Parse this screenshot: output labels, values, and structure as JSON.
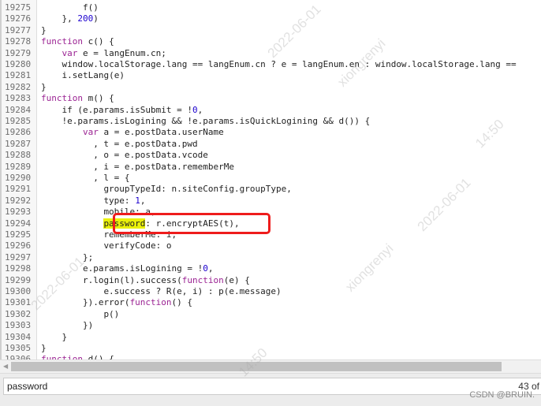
{
  "editor": {
    "lines": [
      {
        "n": "19275",
        "indent": 12,
        "parts": [
          [
            "",
            "f()"
          ]
        ]
      },
      {
        "n": "19276",
        "indent": 8,
        "parts": [
          [
            "",
            "}, "
          ],
          [
            "num",
            "200"
          ],
          [
            "",
            ")"
          ]
        ]
      },
      {
        "n": "19277",
        "indent": 4,
        "parts": [
          [
            "",
            "}"
          ]
        ]
      },
      {
        "n": "19278",
        "indent": 4,
        "parts": [
          [
            "kw",
            "function"
          ],
          [
            "",
            " c() {"
          ]
        ]
      },
      {
        "n": "19279",
        "indent": 8,
        "parts": [
          [
            "kw",
            "var"
          ],
          [
            "",
            " e = langEnum.cn;"
          ]
        ]
      },
      {
        "n": "19280",
        "indent": 8,
        "parts": [
          [
            "",
            "window.localStorage.lang == langEnum.cn ? e = langEnum.en : window.localStorage.lang =="
          ]
        ]
      },
      {
        "n": "19281",
        "indent": 8,
        "parts": [
          [
            "",
            "i.setLang(e)"
          ]
        ]
      },
      {
        "n": "19282",
        "indent": 4,
        "parts": [
          [
            "",
            "}"
          ]
        ]
      },
      {
        "n": "19283",
        "indent": 4,
        "parts": [
          [
            "kw",
            "function"
          ],
          [
            "",
            " m() {"
          ]
        ]
      },
      {
        "n": "19284",
        "indent": 8,
        "parts": [
          [
            "",
            "if (e.params.isSubmit = !"
          ],
          [
            "num",
            "0"
          ],
          [
            "",
            ","
          ]
        ]
      },
      {
        "n": "19285",
        "indent": 8,
        "parts": [
          [
            "",
            "!e.params.isLogining && !e.params.isQuickLogining && d()) {"
          ]
        ]
      },
      {
        "n": "19286",
        "indent": 12,
        "parts": [
          [
            "kw",
            "var"
          ],
          [
            "",
            " a = e.postData.userName"
          ]
        ]
      },
      {
        "n": "19287",
        "indent": 14,
        "parts": [
          [
            "",
            ", t = e.postData.pwd"
          ]
        ]
      },
      {
        "n": "19288",
        "indent": 14,
        "parts": [
          [
            "",
            ", o = e.postData.vcode"
          ]
        ]
      },
      {
        "n": "19289",
        "indent": 14,
        "parts": [
          [
            "",
            ", i = e.postData.rememberMe"
          ]
        ]
      },
      {
        "n": "19290",
        "indent": 14,
        "parts": [
          [
            "",
            ", l = {"
          ]
        ]
      },
      {
        "n": "19291",
        "indent": 16,
        "parts": [
          [
            "",
            "groupTypeId: n.siteConfig.groupType,"
          ]
        ]
      },
      {
        "n": "19292",
        "indent": 16,
        "parts": [
          [
            "",
            "type: "
          ],
          [
            "num",
            "1"
          ],
          [
            "",
            ","
          ]
        ]
      },
      {
        "n": "19293",
        "indent": 16,
        "parts": [
          [
            "",
            "mobile: a,"
          ]
        ]
      },
      {
        "n": "19294",
        "indent": 16,
        "parts": [
          [
            "hl",
            "password"
          ],
          [
            "",
            ": r.encryptAES(t),"
          ]
        ]
      },
      {
        "n": "19295",
        "indent": 16,
        "parts": [
          [
            "",
            "rememberMe: i,"
          ]
        ]
      },
      {
        "n": "19296",
        "indent": 16,
        "parts": [
          [
            "",
            "verifyCode: o"
          ]
        ]
      },
      {
        "n": "19297",
        "indent": 12,
        "parts": [
          [
            "",
            "};"
          ]
        ]
      },
      {
        "n": "19298",
        "indent": 12,
        "parts": [
          [
            "",
            "e.params.isLogining = !"
          ],
          [
            "num",
            "0"
          ],
          [
            "",
            ","
          ]
        ]
      },
      {
        "n": "19299",
        "indent": 12,
        "parts": [
          [
            "",
            "r.login(l).success("
          ],
          [
            "kw",
            "function"
          ],
          [
            "",
            "(e) {"
          ]
        ]
      },
      {
        "n": "19300",
        "indent": 16,
        "parts": [
          [
            "",
            "e.success ? R(e, i) : p(e.message)"
          ]
        ]
      },
      {
        "n": "19301",
        "indent": 12,
        "parts": [
          [
            "",
            "}).error("
          ],
          [
            "kw",
            "function"
          ],
          [
            "",
            "() {"
          ]
        ]
      },
      {
        "n": "19302",
        "indent": 16,
        "parts": [
          [
            "",
            "p()"
          ]
        ]
      },
      {
        "n": "19303",
        "indent": 12,
        "parts": [
          [
            "",
            "})"
          ]
        ]
      },
      {
        "n": "19304",
        "indent": 8,
        "parts": [
          [
            "",
            "}"
          ]
        ]
      },
      {
        "n": "19305",
        "indent": 4,
        "parts": [
          [
            "",
            "}"
          ]
        ]
      },
      {
        "n": "19306",
        "indent": 4,
        "parts": [
          [
            "kw",
            "function"
          ],
          [
            "",
            " d() {"
          ]
        ]
      }
    ]
  },
  "search": {
    "value": "password",
    "count": "43 of"
  },
  "credit": "CSDN @BRUIN.",
  "watermarks": [
    "2022-06-01",
    "xiongrenyi",
    "14:50",
    "2022-06-01",
    "xiongrenyi",
    "2022-06-01",
    "14:50"
  ],
  "colors": {
    "highlight": "#eaf10a",
    "annotation_box": "#ee1c1c",
    "keyword": "#9b2393",
    "number": "#1c00cf"
  }
}
